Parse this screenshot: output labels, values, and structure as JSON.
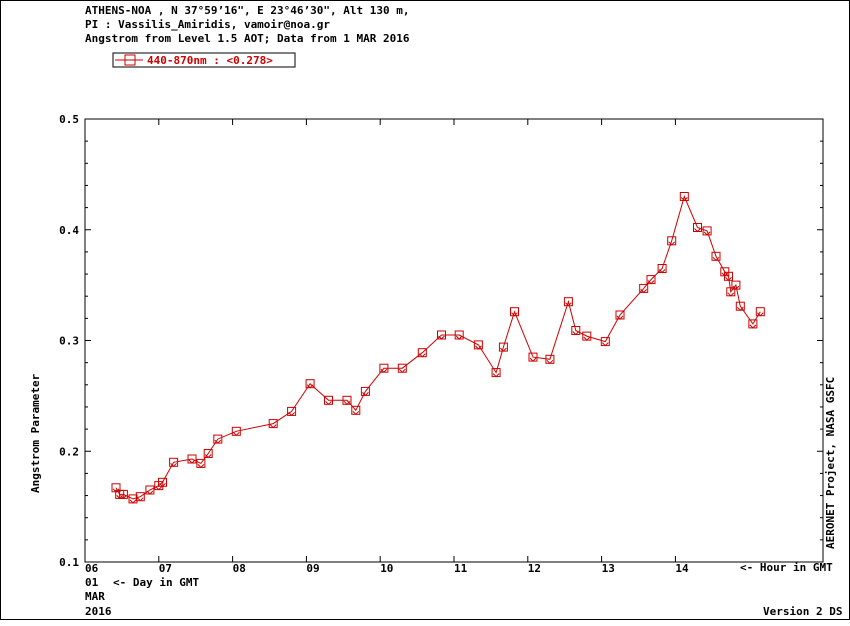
{
  "header": {
    "line1": "ATHENS-NOA , N 37°59’16\", E 23°46’30\", Alt 130 m,",
    "line2": "PI : Vassilis_Amiridis, vamoir@noa.gr",
    "line3": "Angstrom from Level 1.5 AOT; Data from 1 MAR 2016"
  },
  "footer": {
    "date_day": "01",
    "day_label": "<- Day in GMT",
    "date_month": "MAR",
    "date_year": "2016",
    "hour_label": "<- Hour in GMT",
    "version": "Version 2 DS"
  },
  "side_label": "AERONET Project, NASA GSFC",
  "colors": {
    "series": "#cc0000",
    "axis": "#000000"
  },
  "chart_data": {
    "type": "line",
    "title": "",
    "xlabel": "",
    "ylabel": "Angstrom Parameter",
    "xlim": [
      6,
      16
    ],
    "ylim": [
      0.1,
      0.5
    ],
    "x_ticks": [
      "06",
      "07",
      "08",
      "09",
      "10",
      "11",
      "12",
      "13",
      "14"
    ],
    "y_ticks": [
      "0.1",
      "0.2",
      "0.3",
      "0.4",
      "0.5"
    ],
    "grid": false,
    "legend_position": "top-left",
    "series": [
      {
        "name": "440-870nm  : <0.278>",
        "color": "#cc0000",
        "marker": "square",
        "x": [
          6.42,
          6.47,
          6.52,
          6.65,
          6.75,
          6.88,
          7.0,
          7.05,
          7.2,
          7.45,
          7.57,
          7.67,
          7.8,
          8.05,
          8.55,
          8.8,
          9.05,
          9.3,
          9.55,
          9.67,
          9.8,
          10.05,
          10.3,
          10.57,
          10.83,
          11.07,
          11.33,
          11.57,
          11.67,
          11.82,
          12.07,
          12.3,
          12.55,
          12.65,
          12.8,
          13.05,
          13.25,
          13.57,
          13.67,
          13.82,
          13.95,
          14.12,
          14.3,
          14.43,
          14.55,
          14.67,
          14.72,
          14.75,
          14.82,
          14.88,
          15.05,
          15.15
        ],
        "y": [
          0.167,
          0.161,
          0.161,
          0.157,
          0.159,
          0.165,
          0.169,
          0.172,
          0.19,
          0.193,
          0.189,
          0.198,
          0.211,
          0.218,
          0.225,
          0.236,
          0.261,
          0.246,
          0.246,
          0.237,
          0.254,
          0.275,
          0.275,
          0.289,
          0.305,
          0.305,
          0.296,
          0.271,
          0.294,
          0.326,
          0.285,
          0.283,
          0.335,
          0.309,
          0.304,
          0.299,
          0.323,
          0.347,
          0.355,
          0.365,
          0.39,
          0.43,
          0.402,
          0.399,
          0.376,
          0.362,
          0.358,
          0.344,
          0.35,
          0.331,
          0.315,
          0.326
        ]
      }
    ]
  }
}
